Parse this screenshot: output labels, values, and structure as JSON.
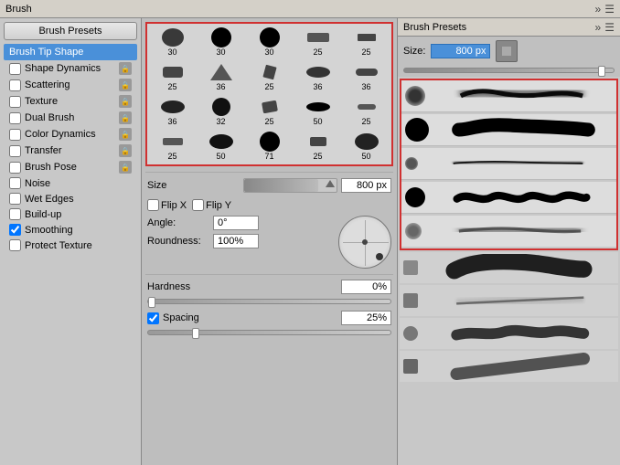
{
  "topBar": {
    "title": "Brush"
  },
  "leftPanel": {
    "brushPresetsBtn": "Brush Presets",
    "menuItems": [
      {
        "id": "brush-tip-shape",
        "label": "Brush Tip Shape",
        "active": true,
        "hasLock": false,
        "hasCheck": false
      },
      {
        "id": "shape-dynamics",
        "label": "Shape Dynamics",
        "active": false,
        "hasLock": true,
        "hasCheck": true
      },
      {
        "id": "scattering",
        "label": "Scattering",
        "active": false,
        "hasLock": true,
        "hasCheck": true
      },
      {
        "id": "texture",
        "label": "Texture",
        "active": false,
        "hasLock": true,
        "hasCheck": true
      },
      {
        "id": "dual-brush",
        "label": "Dual Brush",
        "active": false,
        "hasLock": true,
        "hasCheck": true
      },
      {
        "id": "color-dynamics",
        "label": "Color Dynamics",
        "active": false,
        "hasLock": true,
        "hasCheck": true
      },
      {
        "id": "transfer",
        "label": "Transfer",
        "active": false,
        "hasLock": true,
        "hasCheck": true
      },
      {
        "id": "brush-pose",
        "label": "Brush Pose",
        "active": false,
        "hasLock": true,
        "hasCheck": true
      },
      {
        "id": "noise",
        "label": "Noise",
        "active": false,
        "hasLock": false,
        "hasCheck": true
      },
      {
        "id": "wet-edges",
        "label": "Wet Edges",
        "active": false,
        "hasLock": false,
        "hasCheck": true
      },
      {
        "id": "build-up",
        "label": "Build-up",
        "active": false,
        "hasLock": false,
        "hasCheck": true
      },
      {
        "id": "smoothing",
        "label": "Smoothing",
        "active": false,
        "hasLock": false,
        "hasCheck": true,
        "checked": true
      },
      {
        "id": "protect-texture",
        "label": "Protect Texture",
        "active": false,
        "hasLock": false,
        "hasCheck": true
      }
    ]
  },
  "middlePanel": {
    "brushGrid": {
      "row1": [
        {
          "size": "large",
          "num": "30",
          "selected": true
        },
        {
          "size": "large",
          "num": "30",
          "selected": true
        },
        {
          "size": "large",
          "num": "30",
          "selected": true
        },
        {
          "size": "small",
          "num": "25",
          "selected": false
        },
        {
          "size": "small",
          "num": "25",
          "selected": false
        }
      ],
      "row2": [
        {
          "size": "small",
          "num": "25",
          "selected": false
        },
        {
          "size": "medium",
          "num": "36",
          "selected": false
        },
        {
          "size": "small",
          "num": "25",
          "selected": false
        },
        {
          "size": "medium",
          "num": "36",
          "selected": false
        },
        {
          "size": "medium",
          "num": "36",
          "selected": false
        }
      ],
      "row3": [
        {
          "size": "medium",
          "num": "36",
          "selected": false
        },
        {
          "size": "medium",
          "num": "32",
          "selected": false
        },
        {
          "size": "small",
          "num": "25",
          "selected": false
        },
        {
          "size": "large",
          "num": "50",
          "selected": false
        },
        {
          "size": "small",
          "num": "25",
          "selected": false
        }
      ],
      "row4": [
        {
          "size": "small",
          "num": "25",
          "selected": false
        },
        {
          "size": "large",
          "num": "50",
          "selected": false
        },
        {
          "size": "xlarge",
          "num": "71",
          "selected": false
        },
        {
          "size": "small",
          "num": "25",
          "selected": false
        },
        {
          "size": "large",
          "num": "50",
          "selected": false
        }
      ]
    },
    "size": {
      "label": "Size",
      "value": "800 px"
    },
    "flipX": {
      "label": "Flip X"
    },
    "flipY": {
      "label": "Flip Y"
    },
    "angle": {
      "label": "Angle:",
      "value": "0°"
    },
    "roundness": {
      "label": "Roundness:",
      "value": "100%"
    },
    "hardness": {
      "label": "Hardness",
      "value": "0%"
    },
    "spacing": {
      "label": "Spacing",
      "value": "25%",
      "checked": true
    }
  },
  "rightPanel": {
    "title": "Brush Presets",
    "size": {
      "label": "Size:",
      "value": "800 px"
    },
    "presets": [
      {
        "id": "p1",
        "dotSize": "large",
        "selected": true,
        "strokeType": "soft-wide"
      },
      {
        "id": "p2",
        "dotSize": "xlarge",
        "selected": true,
        "strokeType": "hard-tapered"
      },
      {
        "id": "p3",
        "dotSize": "small",
        "selected": true,
        "strokeType": "thin-tapered"
      },
      {
        "id": "p4",
        "dotSize": "large",
        "selected": true,
        "strokeType": "wavy"
      },
      {
        "id": "p5",
        "dotSize": "medium",
        "selected": true,
        "strokeType": "soft-diffuse"
      },
      {
        "id": "p6",
        "dotSize": "xlarge",
        "selected": false,
        "strokeType": "thick-brush"
      },
      {
        "id": "p7",
        "dotSize": "small",
        "selected": false,
        "strokeType": "brush-stroke2"
      },
      {
        "id": "p8",
        "dotSize": "small",
        "selected": false,
        "strokeType": "scruffy"
      },
      {
        "id": "p9",
        "dotSize": "small",
        "selected": false,
        "strokeType": "diagonal"
      }
    ]
  }
}
